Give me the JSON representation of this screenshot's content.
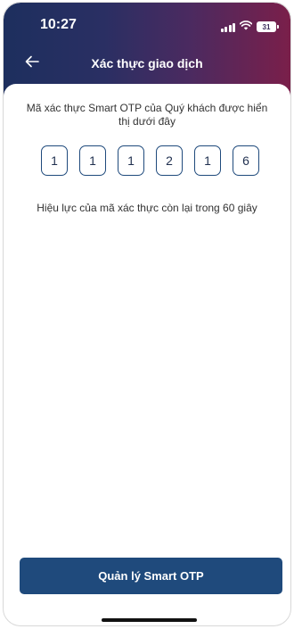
{
  "status_bar": {
    "time": "10:27",
    "battery": "31",
    "icons": [
      "signal-icon",
      "wifi-icon",
      "battery-icon"
    ]
  },
  "header": {
    "title": "Xác thực giao dịch",
    "back_icon": "arrow-left-icon",
    "gradient": [
      "#1d2f5e",
      "#7a1f4a"
    ]
  },
  "main": {
    "instruction": "Mã xác thực Smart OTP của Quý khách được hiển thị dưới đây",
    "otp_digits": [
      "1",
      "1",
      "1",
      "2",
      "1",
      "6"
    ],
    "validity": "Hiệu lực của mã xác thực còn lại trong 60 giây"
  },
  "footer": {
    "manage_button": "Quản lý Smart OTP",
    "button_color": "#1f4a7c"
  }
}
